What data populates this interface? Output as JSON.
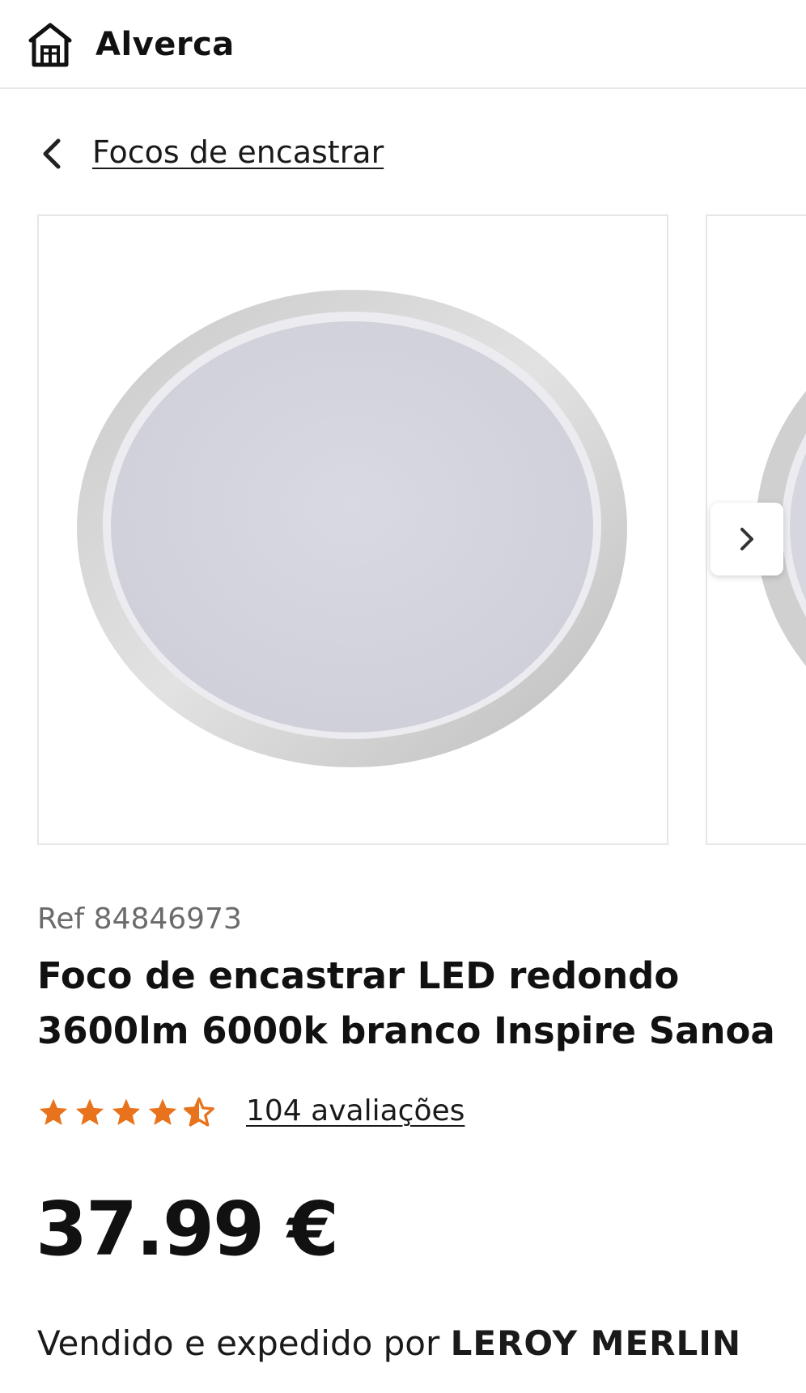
{
  "header": {
    "store_icon": "store-house-icon",
    "store_name": "Alverca"
  },
  "breadcrumb": {
    "back_icon": "chevron-left-icon",
    "label": "Focos de encastrar"
  },
  "gallery": {
    "next_icon": "chevron-right-icon",
    "images": [
      "product-image-1",
      "product-image-2"
    ]
  },
  "product": {
    "ref": "Ref 84846973",
    "title": "Foco de encastrar LED redondo 3600lm 6000k branco Inspire Sanoa",
    "rating": {
      "value": 4.5,
      "max": 5,
      "reviews_label": "104 avaliações",
      "star_color": "#e8731c"
    },
    "price": "37.99 €",
    "seller_prefix": "Vendido e expedido por",
    "seller_name": "LEROY MERLIN"
  }
}
